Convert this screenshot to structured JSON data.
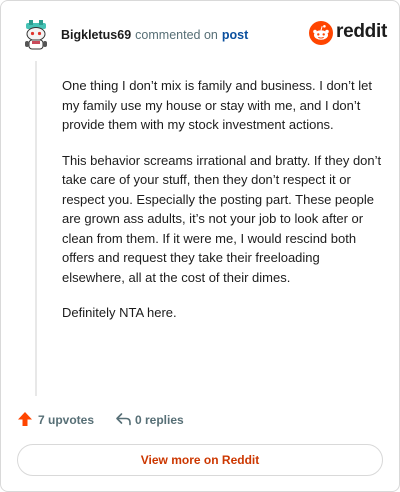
{
  "header": {
    "username": "Bigkletus69",
    "verb": "commented on",
    "post_link": "post",
    "brand_word": "reddit",
    "brand_icon": "reddit-snoo-icon",
    "avatar_icon": "snoo-avatar"
  },
  "comment": {
    "paragraphs": [
      "One thing I don’t mix is family and business. I don’t let my family use my house or stay with me, and I don’t provide them with my stock investment actions.",
      "This behavior screams irrational and bratty. If they don’t take care of your stuff, then they don’t respect it or respect you. Especially the posting part. These people are grown ass adults, it’s not your job to look after or clean from them. If it were me, I would rescind both offers and request they take their freeloading elsewhere, all at the cost of their dimes.",
      "Definitely NTA here."
    ]
  },
  "footer": {
    "upvotes_label": "7 upvotes",
    "replies_label": "0 replies"
  },
  "cta": {
    "label": "View more on Reddit"
  },
  "colors": {
    "brand_orange": "#ff4500",
    "link_blue": "#0a4f9e",
    "cta_text": "#cc3700",
    "meta_gray": "#576f76"
  }
}
